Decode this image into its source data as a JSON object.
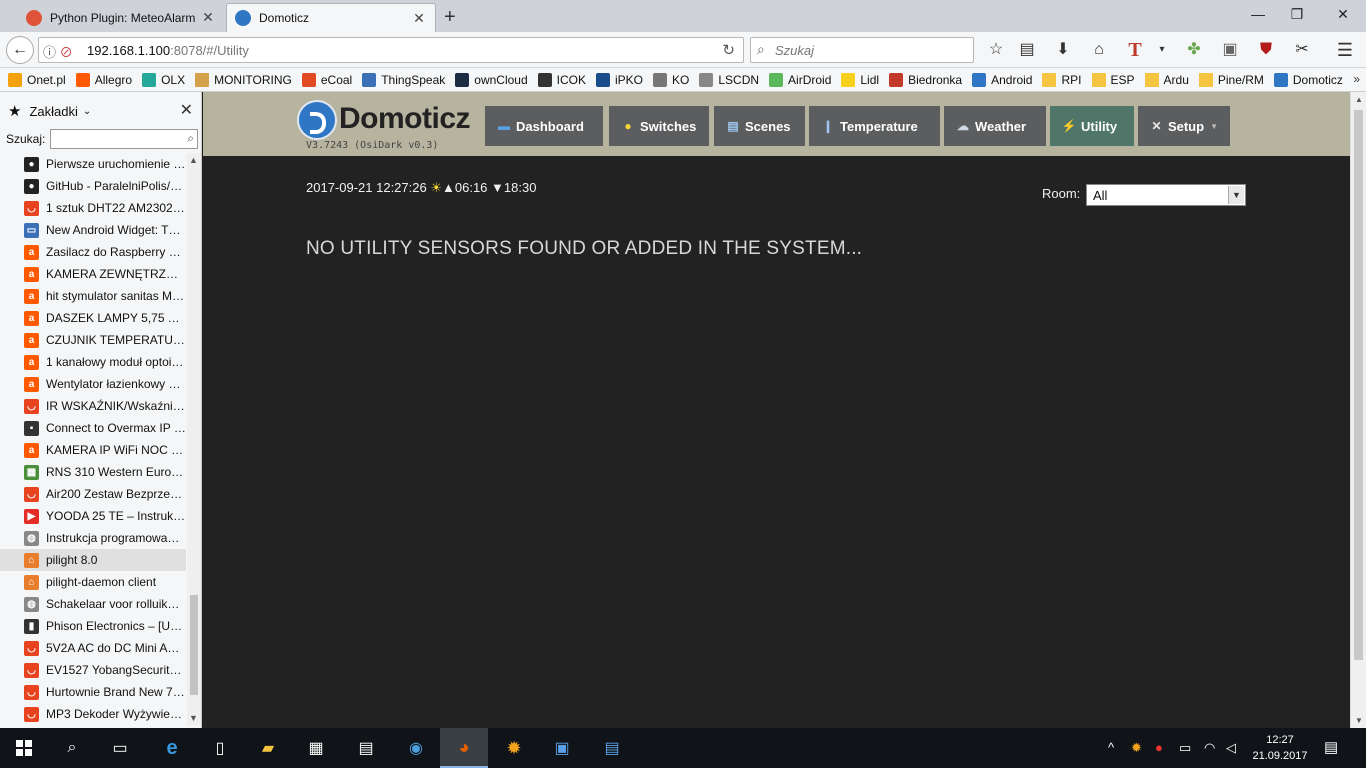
{
  "tabs": [
    {
      "title": "Python Plugin: MeteoAlarm",
      "active": false,
      "color": "#e0533b"
    },
    {
      "title": "Domoticz",
      "active": true,
      "color": "#2f76c4"
    }
  ],
  "url": {
    "host": "192.168.1.100",
    "rest": ":8078/#/Utility"
  },
  "search_placeholder": "Szukaj",
  "bookmarks_bar": [
    {
      "label": "Onet.pl",
      "icon": "onet-icon",
      "color": "#f2a20c"
    },
    {
      "label": "Allegro",
      "icon": "allegro-icon",
      "color": "#ff5a00"
    },
    {
      "label": "OLX",
      "icon": "olx-icon",
      "color": "#23a89a"
    },
    {
      "label": "MONITORING",
      "icon": "folder-icon",
      "color": "#d4a24a"
    },
    {
      "label": "eCoal",
      "icon": "ecoal-icon",
      "color": "#e04b24"
    },
    {
      "label": "ThingSpeak",
      "icon": "thingspeak-icon",
      "color": "#3b6fb6"
    },
    {
      "label": "ownCloud",
      "icon": "owncloud-icon",
      "color": "#1d2d44"
    },
    {
      "label": "ICOK",
      "icon": "icok-icon",
      "color": "#333333"
    },
    {
      "label": "iPKO",
      "icon": "ipko-icon",
      "color": "#1b4c8c"
    },
    {
      "label": "KO",
      "icon": "ko-icon",
      "color": "#777777"
    },
    {
      "label": "LSCDN",
      "icon": "globe-icon",
      "color": "#888888"
    },
    {
      "label": "AirDroid",
      "icon": "airdroid-icon",
      "color": "#5cb85c"
    },
    {
      "label": "Lidl",
      "icon": "lidl-icon",
      "color": "#f6d01b"
    },
    {
      "label": "Biedronka",
      "icon": "biedronka-icon",
      "color": "#c0392b"
    },
    {
      "label": "Android",
      "icon": "android-icon",
      "color": "#2f76c4"
    },
    {
      "label": "RPI",
      "icon": "folder-icon",
      "color": "#f5c542"
    },
    {
      "label": "ESP",
      "icon": "folder-icon",
      "color": "#f5c542"
    },
    {
      "label": "Ardu",
      "icon": "folder-icon",
      "color": "#f5c542"
    },
    {
      "label": "Pine/RM",
      "icon": "folder-icon",
      "color": "#f5c542"
    },
    {
      "label": "Domoticz",
      "icon": "domoticz-icon",
      "color": "#2f76c4"
    }
  ],
  "sidebar": {
    "title": "Zakładki",
    "search_label": "Szukaj:",
    "items": [
      {
        "label": "Pierwsze uruchomienie …",
        "icon": "github-icon",
        "color": "#222222",
        "glyph": "●"
      },
      {
        "label": "GitHub - ParalelniPolis/r…",
        "icon": "github-icon",
        "color": "#222222",
        "glyph": "●"
      },
      {
        "label": "1 sztuk DHT22 AM2302 …",
        "icon": "aliexpress-icon",
        "color": "#e8431f",
        "glyph": "◡"
      },
      {
        "label": "New Android Widget: T…",
        "icon": "comment-icon",
        "color": "#3b6fb6",
        "glyph": "▭"
      },
      {
        "label": "Zasilacz do Raspberry Pi…",
        "icon": "allegro-icon",
        "color": "#ff5a00",
        "glyph": "a"
      },
      {
        "label": "KAMERA ZEWNĘTRZNA…",
        "icon": "allegro-icon",
        "color": "#ff5a00",
        "glyph": "a"
      },
      {
        "label": "hit stymulator sanitas M…",
        "icon": "allegro-icon",
        "color": "#ff5a00",
        "glyph": "a"
      },
      {
        "label": "DASZEK LAMPY 5,75 YA…",
        "icon": "allegro-icon",
        "color": "#ff5a00",
        "glyph": "a"
      },
      {
        "label": "CZUJNIK TEMPERATUR…",
        "icon": "allegro-icon",
        "color": "#ff5a00",
        "glyph": "a"
      },
      {
        "label": "1 kanałowy moduł optoi…",
        "icon": "allegro-icon",
        "color": "#ff5a00",
        "glyph": "a"
      },
      {
        "label": "Wentylator łazienkowy V…",
        "icon": "allegro-icon",
        "color": "#ff5a00",
        "glyph": "a"
      },
      {
        "label": "IR WSKAŹNIK/Wskaźnik …",
        "icon": "aliexpress-icon",
        "color": "#e8431f",
        "glyph": "◡"
      },
      {
        "label": "Connect to Overmax IP …",
        "icon": "camera-icon",
        "color": "#333333",
        "glyph": "▪"
      },
      {
        "label": "KAMERA IP WiFi NOC IR…",
        "icon": "allegro-icon",
        "color": "#ff5a00",
        "glyph": "a"
      },
      {
        "label": "RNS 310 Western Europe…",
        "icon": "grid-icon",
        "color": "#4a8f3c",
        "glyph": "▦"
      },
      {
        "label": "Air200 Zestaw Bezprzew…",
        "icon": "aliexpress-icon",
        "color": "#e8431f",
        "glyph": "◡"
      },
      {
        "label": "YOODA 25 TE – Instrukcj…",
        "icon": "youtube-icon",
        "color": "#e52d27",
        "glyph": "▶"
      },
      {
        "label": "Instrukcja programowan…",
        "icon": "globe-icon",
        "color": "#888888",
        "glyph": "◍"
      },
      {
        "label": "pilight 8.0",
        "icon": "pilight-icon",
        "color": "#e87d2c",
        "glyph": "⌂",
        "selected": true
      },
      {
        "label": "pilight-daemon client",
        "icon": "pilight-icon",
        "color": "#e87d2c",
        "glyph": "⌂"
      },
      {
        "label": "Schakelaar voor rolluike…",
        "icon": "globe-icon",
        "color": "#888888",
        "glyph": "◍"
      },
      {
        "label": "Phison Electronics – [US…",
        "icon": "usb-icon",
        "color": "#333333",
        "glyph": "▮"
      },
      {
        "label": "5V2A AC do DC Mini Ad…",
        "icon": "aliexpress-icon",
        "color": "#e8431f",
        "glyph": "◡"
      },
      {
        "label": "EV1527 YobangSecurity …",
        "icon": "aliexpress-icon",
        "color": "#e8431f",
        "glyph": "◡"
      },
      {
        "label": "Hurtownie Brand New 7 …",
        "icon": "aliexpress-icon",
        "color": "#e8431f",
        "glyph": "◡"
      },
      {
        "label": "MP3 Dekoder Wyżywien…",
        "icon": "aliexpress-icon",
        "color": "#e8431f",
        "glyph": "◡"
      }
    ]
  },
  "app": {
    "brand": "Domoticz",
    "version": "V3.7243 (OsiDark v0.3)",
    "nav": [
      {
        "label": "Dashboard",
        "icon": "dashboard-icon",
        "glyph": "▬",
        "active": false
      },
      {
        "label": "Switches",
        "icon": "lightbulb-icon",
        "glyph": "💡",
        "active": false
      },
      {
        "label": "Scenes",
        "icon": "scenes-icon",
        "glyph": "▤",
        "active": false
      },
      {
        "label": "Temperature",
        "icon": "thermometer-icon",
        "glyph": "🌡",
        "active": false
      },
      {
        "label": "Weather",
        "icon": "weather-icon",
        "glyph": "☁",
        "active": false
      },
      {
        "label": "Utility",
        "icon": "utility-icon",
        "glyph": "⚡",
        "active": true
      },
      {
        "label": "Setup",
        "icon": "setup-icon",
        "glyph": "⚒",
        "active": false,
        "dropdown": true
      }
    ],
    "datetime": "2017-09-21 12:27:26",
    "sunrise": "06:16",
    "sunset": "18:30",
    "room_label": "Room:",
    "room_value": "All",
    "empty_message": "NO UTILITY SENSORS FOUND OR ADDED IN THE SYSTEM..."
  },
  "taskbar": {
    "time": "12:27",
    "date": "21.09.2017"
  },
  "colors": {
    "header_bg": "#b6b39e",
    "page_bg": "#222222",
    "nav_bg": "#5c5d5f",
    "nav_active": "#4f7668"
  }
}
